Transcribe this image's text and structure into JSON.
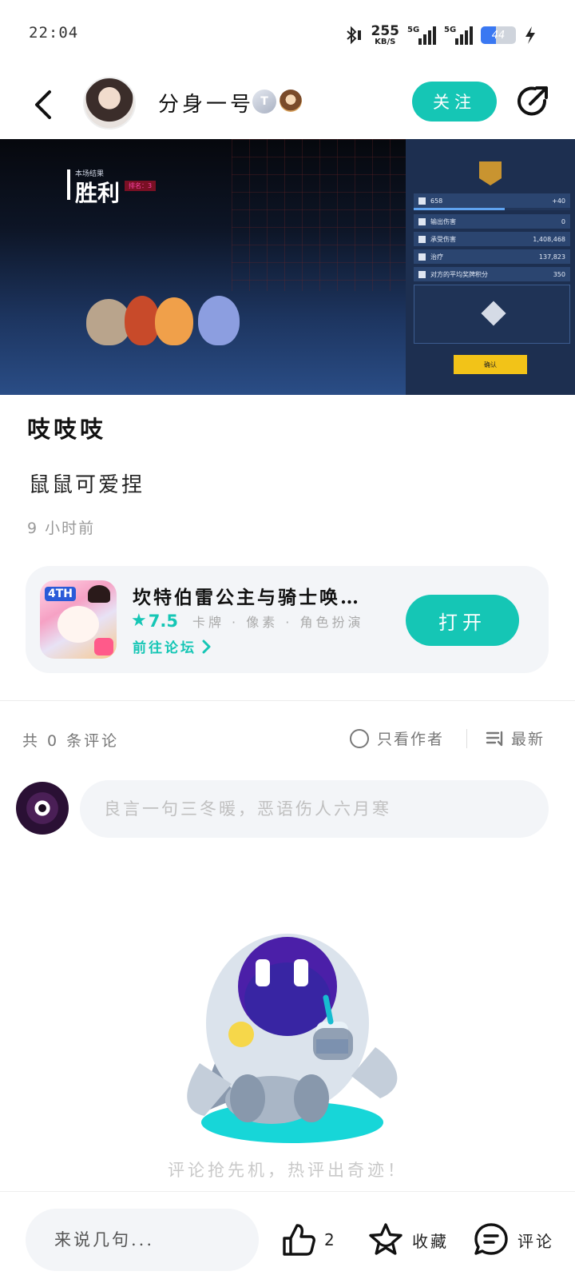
{
  "status_bar": {
    "time": "22:04",
    "net_speed": "255",
    "net_unit": "KB/S",
    "signal_1_label": "5G",
    "signal_2_label": "5G",
    "battery": "44",
    "battery_level": 0.44
  },
  "header": {
    "author_name": "分身一号",
    "level_badge": "T",
    "follow_label": "关注"
  },
  "banner": {
    "result_small": "本场结果",
    "result_title": "胜利",
    "rank_tag": "排名：3",
    "stats": [
      {
        "label": "658",
        "value": "+40"
      },
      {
        "label": "输出伤害",
        "value": "0"
      },
      {
        "label": "承受伤害",
        "value": "1,408,468"
      },
      {
        "label": "治疗",
        "value": "137,823"
      },
      {
        "label": "对方的平均奖牌积分",
        "value": "350"
      }
    ],
    "confirm_label": "确认"
  },
  "post": {
    "title": "吱吱吱",
    "body": "鼠鼠可爱捏",
    "time": "9 小时前"
  },
  "game": {
    "icon_tag": "4TH",
    "name": "坎特伯雷公主与骑士唤…",
    "rating": "7.5",
    "tags": "卡牌 · 像素 · 角色扮演",
    "forum_link": "前往论坛",
    "open_label": "打开"
  },
  "comments": {
    "count_text": "共 0 条评论",
    "only_author": "只看作者",
    "sort": "最新",
    "input_placeholder": "良言一句三冬暖，恶语伤人六月寒",
    "empty_text": "评论抢先机，热评出奇迹！"
  },
  "bottom_bar": {
    "say_placeholder": "来说几句...",
    "like_count": "2",
    "favorite_label": "收藏",
    "comment_label": "评论"
  },
  "colors": {
    "accent": "#15c6b5",
    "muted_text": "#999999",
    "card_bg": "#f3f5f8"
  }
}
